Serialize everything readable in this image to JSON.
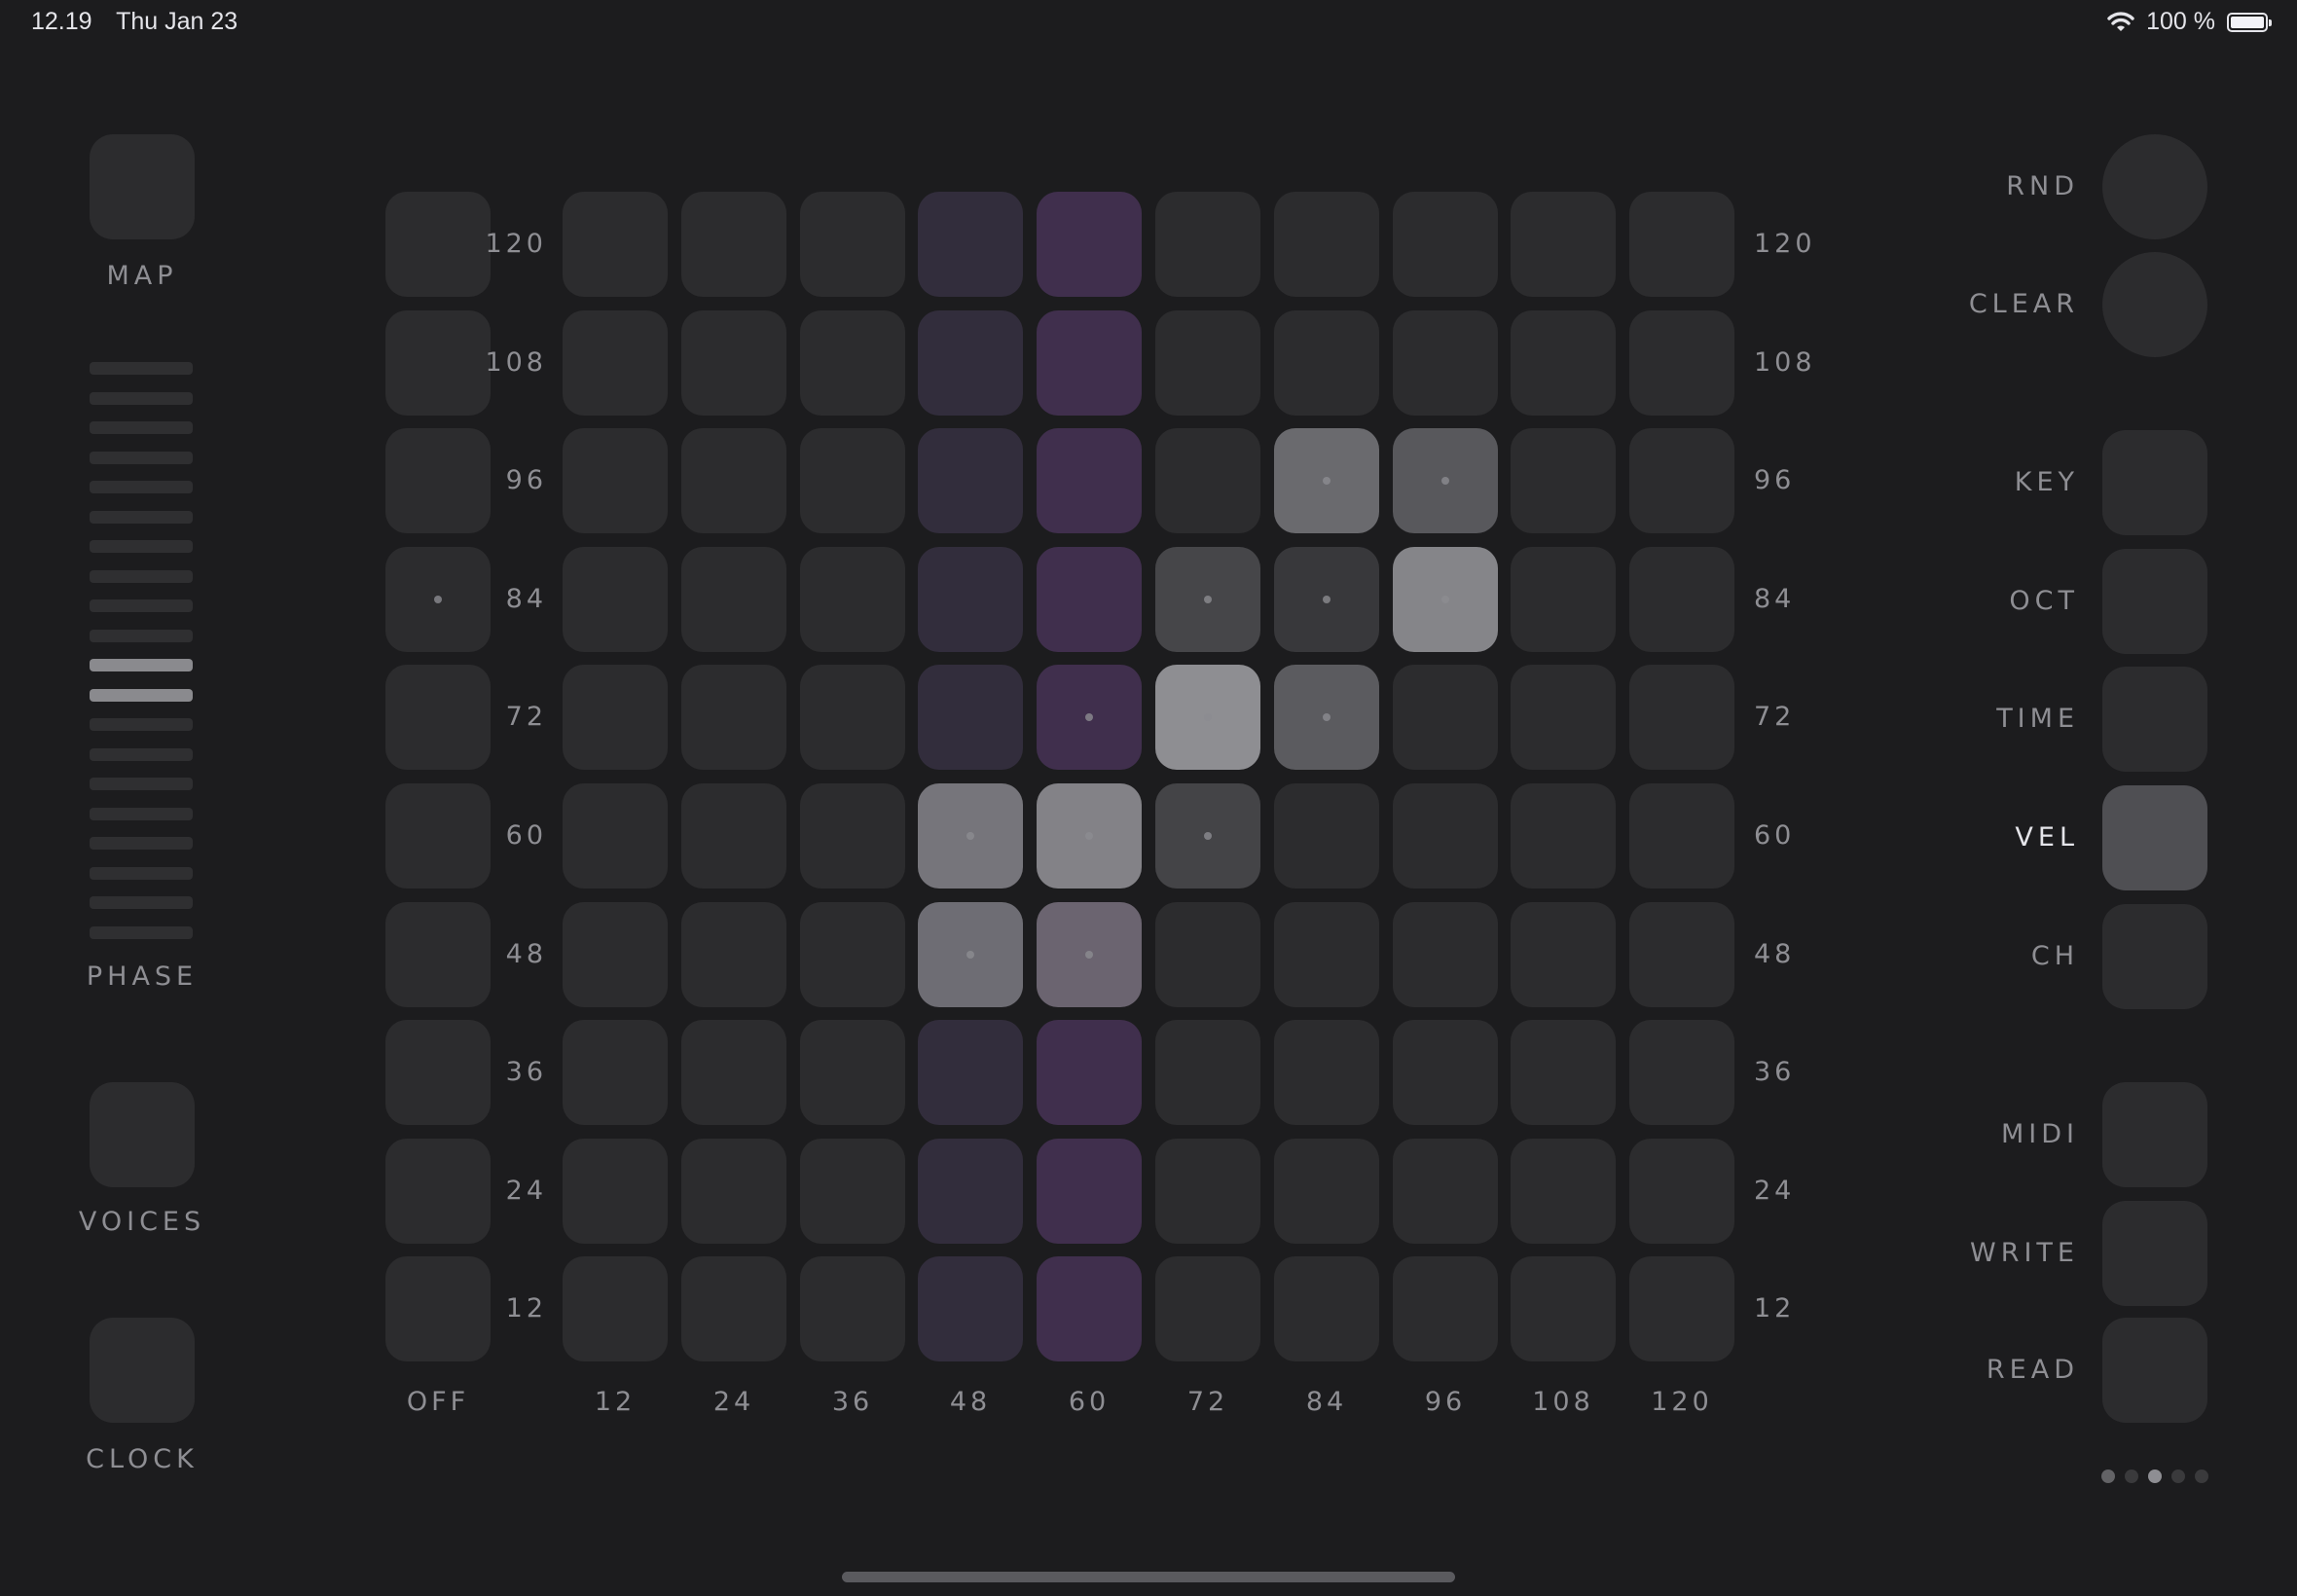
{
  "status_bar": {
    "time": "12.19",
    "date": "Thu Jan 23",
    "battery_text": "100 %"
  },
  "left_panel": {
    "map_label": "MAP",
    "phase_label": "PHASE",
    "voices_label": "VOICES",
    "clock_label": "CLOCK",
    "phase_total_steps": 20,
    "phase_active_steps": [
      10,
      11
    ]
  },
  "grid": {
    "row_labels": [
      "120",
      "108",
      "96",
      "84",
      "72",
      "60",
      "48",
      "36",
      "24",
      "12"
    ],
    "column_labels": [
      "OFF",
      "12",
      "24",
      "36",
      "48",
      "60",
      "72",
      "84",
      "96",
      "108",
      "120"
    ],
    "colors": {
      "empty": "#2c2c2e",
      "purple_dim": "#322d3c",
      "purple": "#402f4d"
    },
    "lit_cells": [
      {
        "row": 2,
        "col": 7,
        "color": "#6a6a6e",
        "dot": true
      },
      {
        "row": 2,
        "col": 8,
        "color": "#58585c",
        "dot": true
      },
      {
        "row": 3,
        "col": 0,
        "color": "#2c2c2e",
        "dot": true
      },
      {
        "row": 3,
        "col": 6,
        "color": "#464649",
        "dot": true
      },
      {
        "row": 3,
        "col": 7,
        "color": "#38383b",
        "dot": true
      },
      {
        "row": 3,
        "col": 8,
        "color": "#858589",
        "dot": true
      },
      {
        "row": 4,
        "col": 5,
        "color": "#402f4d",
        "dot": true
      },
      {
        "row": 4,
        "col": 6,
        "color": "#8e8e92",
        "dot": true
      },
      {
        "row": 4,
        "col": 7,
        "color": "#5b5b5f",
        "dot": true
      },
      {
        "row": 5,
        "col": 4,
        "color": "#76757b",
        "dot": true
      },
      {
        "row": 5,
        "col": 5,
        "color": "#838287",
        "dot": true
      },
      {
        "row": 5,
        "col": 6,
        "color": "#444447",
        "dot": true
      },
      {
        "row": 6,
        "col": 4,
        "color": "#6e6d74",
        "dot": true
      },
      {
        "row": 6,
        "col": 5,
        "color": "#6b6470",
        "dot": true
      }
    ]
  },
  "right_panel": {
    "buttons": [
      {
        "label": "RND",
        "shape": "round",
        "active": false
      },
      {
        "label": "CLEAR",
        "shape": "round",
        "active": false
      },
      {
        "label": "KEY",
        "shape": "square",
        "active": false
      },
      {
        "label": "OCT",
        "shape": "square",
        "active": false
      },
      {
        "label": "TIME",
        "shape": "square",
        "active": false
      },
      {
        "label": "VEL",
        "shape": "square",
        "active": true
      },
      {
        "label": "CH",
        "shape": "square",
        "active": false
      },
      {
        "label": "MIDI",
        "shape": "square",
        "active": false
      },
      {
        "label": "WRITE",
        "shape": "square",
        "active": false
      },
      {
        "label": "READ",
        "shape": "square",
        "active": false
      }
    ],
    "active_color": "#4f4f53",
    "page_count": 5,
    "current_page": 3
  }
}
